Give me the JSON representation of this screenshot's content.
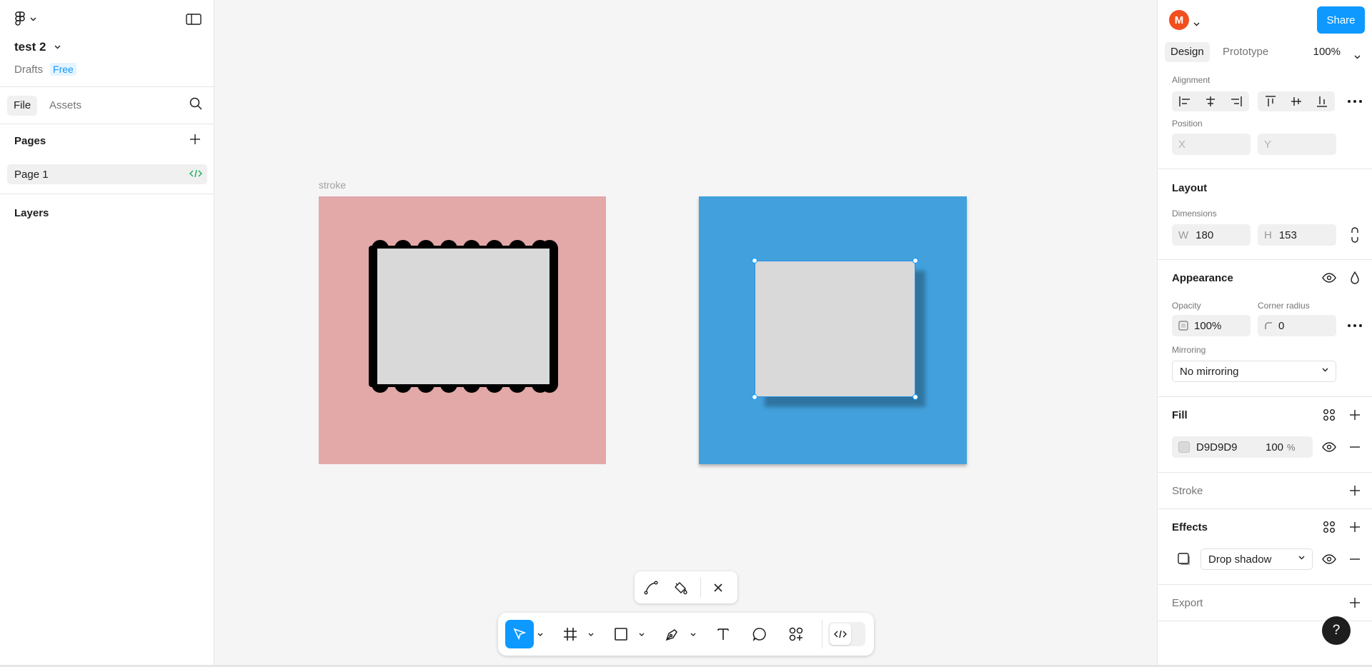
{
  "left_panel": {
    "file_name": "test 2",
    "drafts_label": "Drafts",
    "plan_badge": "Free",
    "tabs": {
      "file": "File",
      "assets": "Assets"
    },
    "pages_heading": "Pages",
    "pages": [
      {
        "label": "Page 1"
      }
    ],
    "layers_heading": "Layers"
  },
  "canvas": {
    "frame_title": "stroke",
    "colors": {
      "pink_frame": "#E3A8A8",
      "blue_frame": "#42A1DD",
      "rect_fill": "#D9D9D9",
      "selection": "#0D99FF"
    }
  },
  "right_panel": {
    "avatar_initial": "M",
    "share_label": "Share",
    "tabs": {
      "design": "Design",
      "prototype": "Prototype"
    },
    "zoom": "100%",
    "alignment_label": "Alignment",
    "position_label": "Position",
    "position": {
      "x_placeholder": "X",
      "y_placeholder": "Y"
    },
    "layout_title": "Layout",
    "dimensions_label": "Dimensions",
    "dimensions": {
      "w_prefix": "W",
      "w": "180",
      "h_prefix": "H",
      "h": "153"
    },
    "appearance_title": "Appearance",
    "opacity_label": "Opacity",
    "opacity": "100%",
    "corner_radius_label": "Corner radius",
    "corner_radius": "0",
    "mirroring_label": "Mirroring",
    "mirroring_value": "No mirroring",
    "fill_title": "Fill",
    "fill": {
      "hex": "D9D9D9",
      "opacity": "100",
      "unit": "%",
      "swatch": "#D9D9D9"
    },
    "stroke_title": "Stroke",
    "effects_title": "Effects",
    "effect_type": "Drop shadow",
    "export_title": "Export",
    "help": "?"
  },
  "accent_color": "#0D99FF"
}
